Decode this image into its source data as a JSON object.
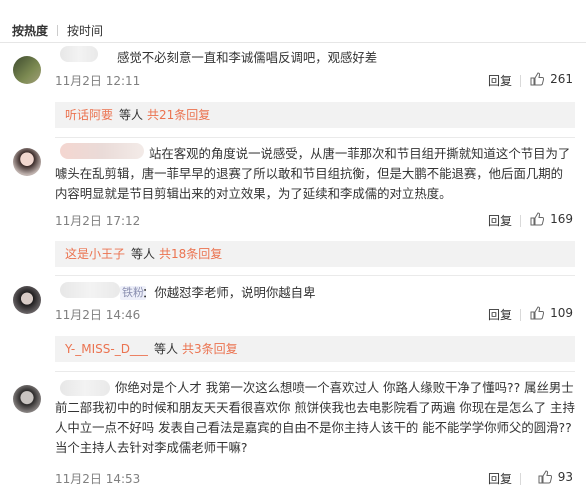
{
  "sort": {
    "hot": "按热度",
    "time": "按时间"
  },
  "comments": [
    {
      "text": "感觉不必刻意一直和李诚儒唱反调吧，观感好差",
      "date": "11月2日 12:11",
      "reply": "回复",
      "likes": "261",
      "sub": {
        "who": "听话阿要",
        "etc": "等人",
        "total": "共21条回复"
      }
    },
    {
      "text": "站在客观的角度说一说感受，从唐一菲那次和节目组开撕就知道这个节目为了噱头在乱剪辑，唐一菲早早的退赛了所以敢和节目组抗衡，但是大鹏不能退赛，他后面几期的内容明显就是节目剪辑出来的对立效果，为了延续和李成儒的对立热度。",
      "date": "11月2日 17:12",
      "reply": "回复",
      "likes": "169",
      "sub": {
        "who": "这是小王子",
        "etc": "等人",
        "total": "共18条回复"
      }
    },
    {
      "badge": "铁粉",
      "text": "：你越怼李老师，说明你越自卑",
      "date": "11月2日 14:46",
      "reply": "回复",
      "likes": "109",
      "sub": {
        "who": "Y-_MISS-_D___",
        "etc": "等人",
        "total": "共3条回复"
      }
    },
    {
      "text": "你绝对是个人才 我第一次这么想喷一个喜欢过人 你路人缘败干净了懂吗?? 属丝男士前二部我初中的时候和朋友天天看很喜欢你 煎饼侠我也去电影院看了两遍 你现在是怎么了 主持人中立一点不好吗 发表自己看法是嘉宾的自由不是你主持人该干的 能不能学学你师父的圆滑?? 当个主持人去针对李成儒老师干嘛?",
      "date": "11月2日 14:53",
      "reply": "回复",
      "likes": "93"
    }
  ]
}
